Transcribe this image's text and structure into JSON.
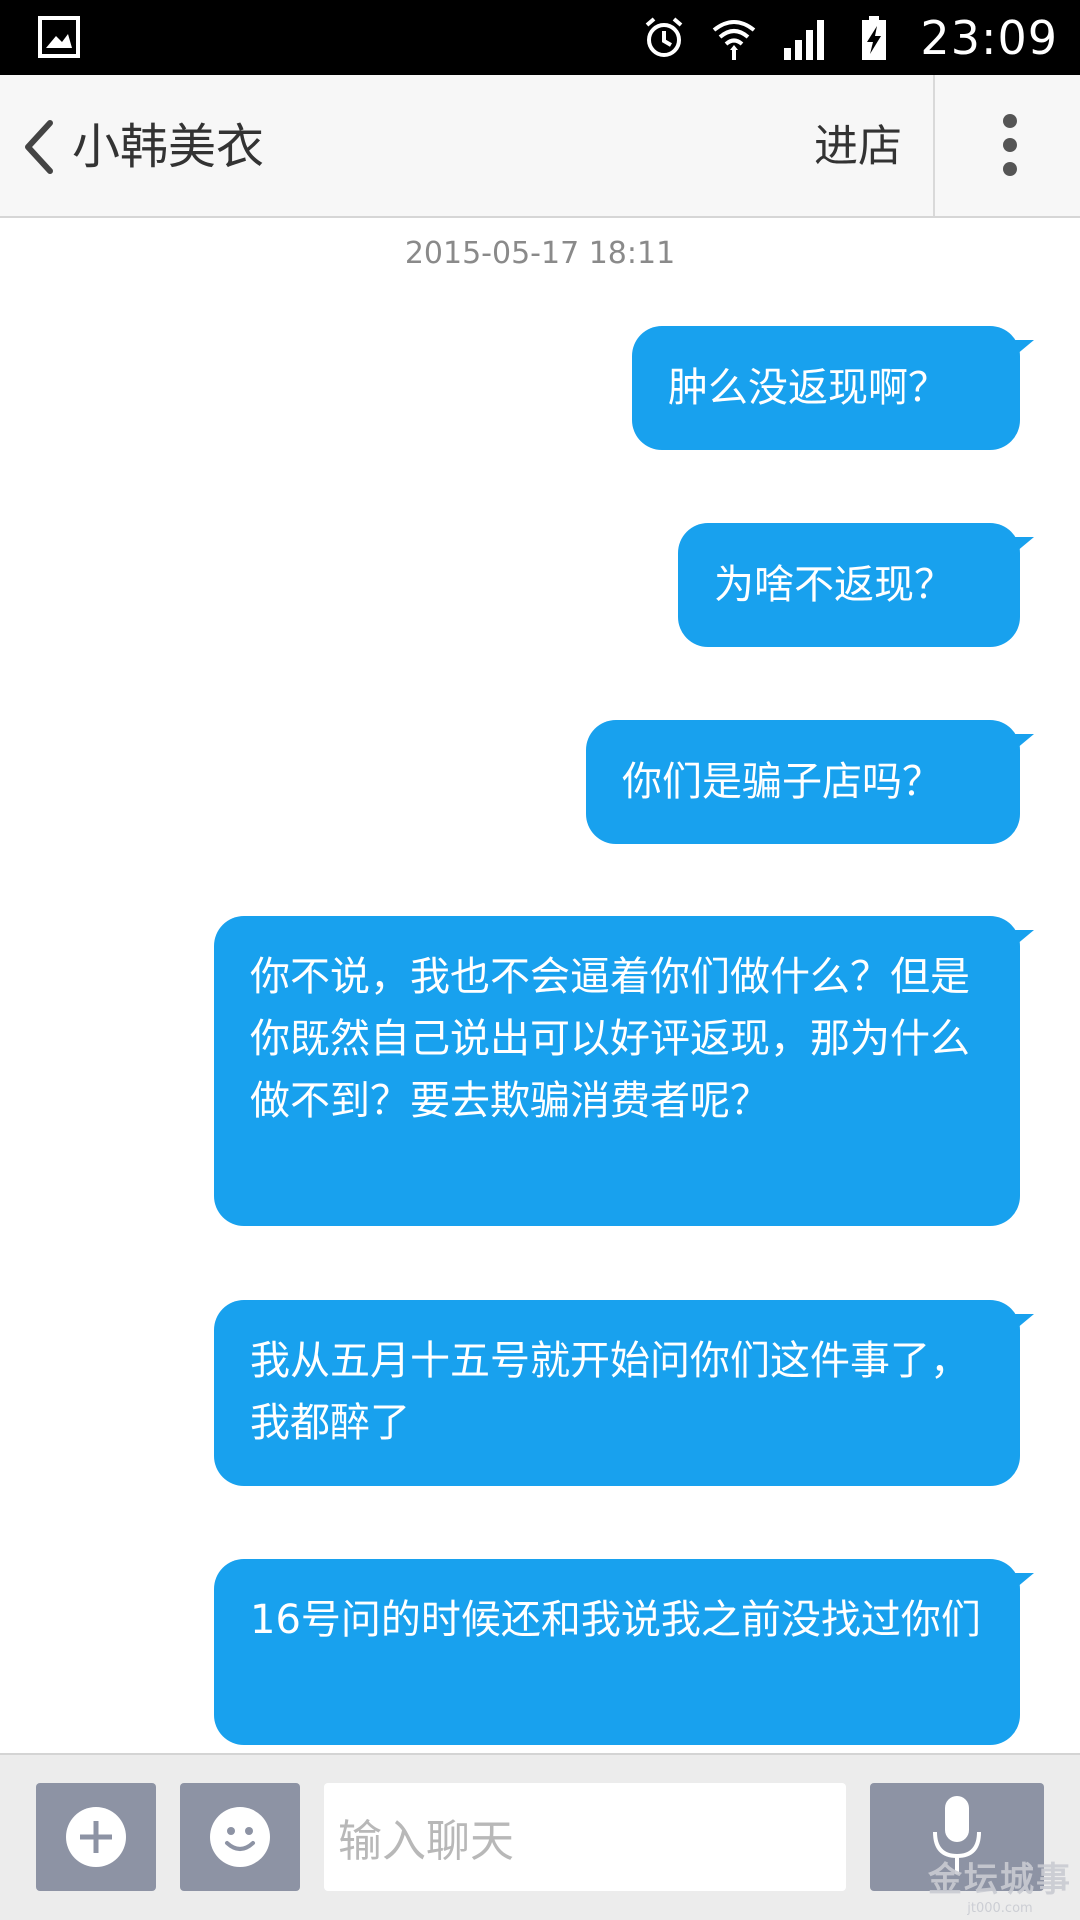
{
  "status_bar": {
    "time": "23:09",
    "icons": [
      "gallery-icon",
      "alarm-icon",
      "wifi-icon",
      "signal-icon",
      "battery-charging-icon"
    ]
  },
  "header": {
    "back_icon": "chevron-left-icon",
    "title": "小韩美衣",
    "enter_shop_label": "进店",
    "more_icon": "more-vertical-icon"
  },
  "chat": {
    "timestamp": "2015-05-17 18:11",
    "bubble_color": "#18a1ee",
    "messages": [
      {
        "text": "肿么没返现啊？"
      },
      {
        "text": "为啥不返现？"
      },
      {
        "text": "你们是骗子店吗？"
      },
      {
        "text": "你不说，我也不会逼着你们做什么？但是你既然自己说出可以好评返现，那为什么做不到？要去欺骗消费者呢？"
      },
      {
        "text": "我从五月十五号就开始问你们这件事了，我都醉了"
      },
      {
        "text": "16号问的时候还和我说我之前没找过你们"
      }
    ]
  },
  "input_bar": {
    "add_icon": "plus-circle-icon",
    "emoji_icon": "smiley-icon",
    "placeholder": "输入聊天",
    "mic_icon": "microphone-icon",
    "button_color": "#8d93a4"
  },
  "watermark": {
    "text": "金坛城事",
    "url": "jt000.com"
  }
}
